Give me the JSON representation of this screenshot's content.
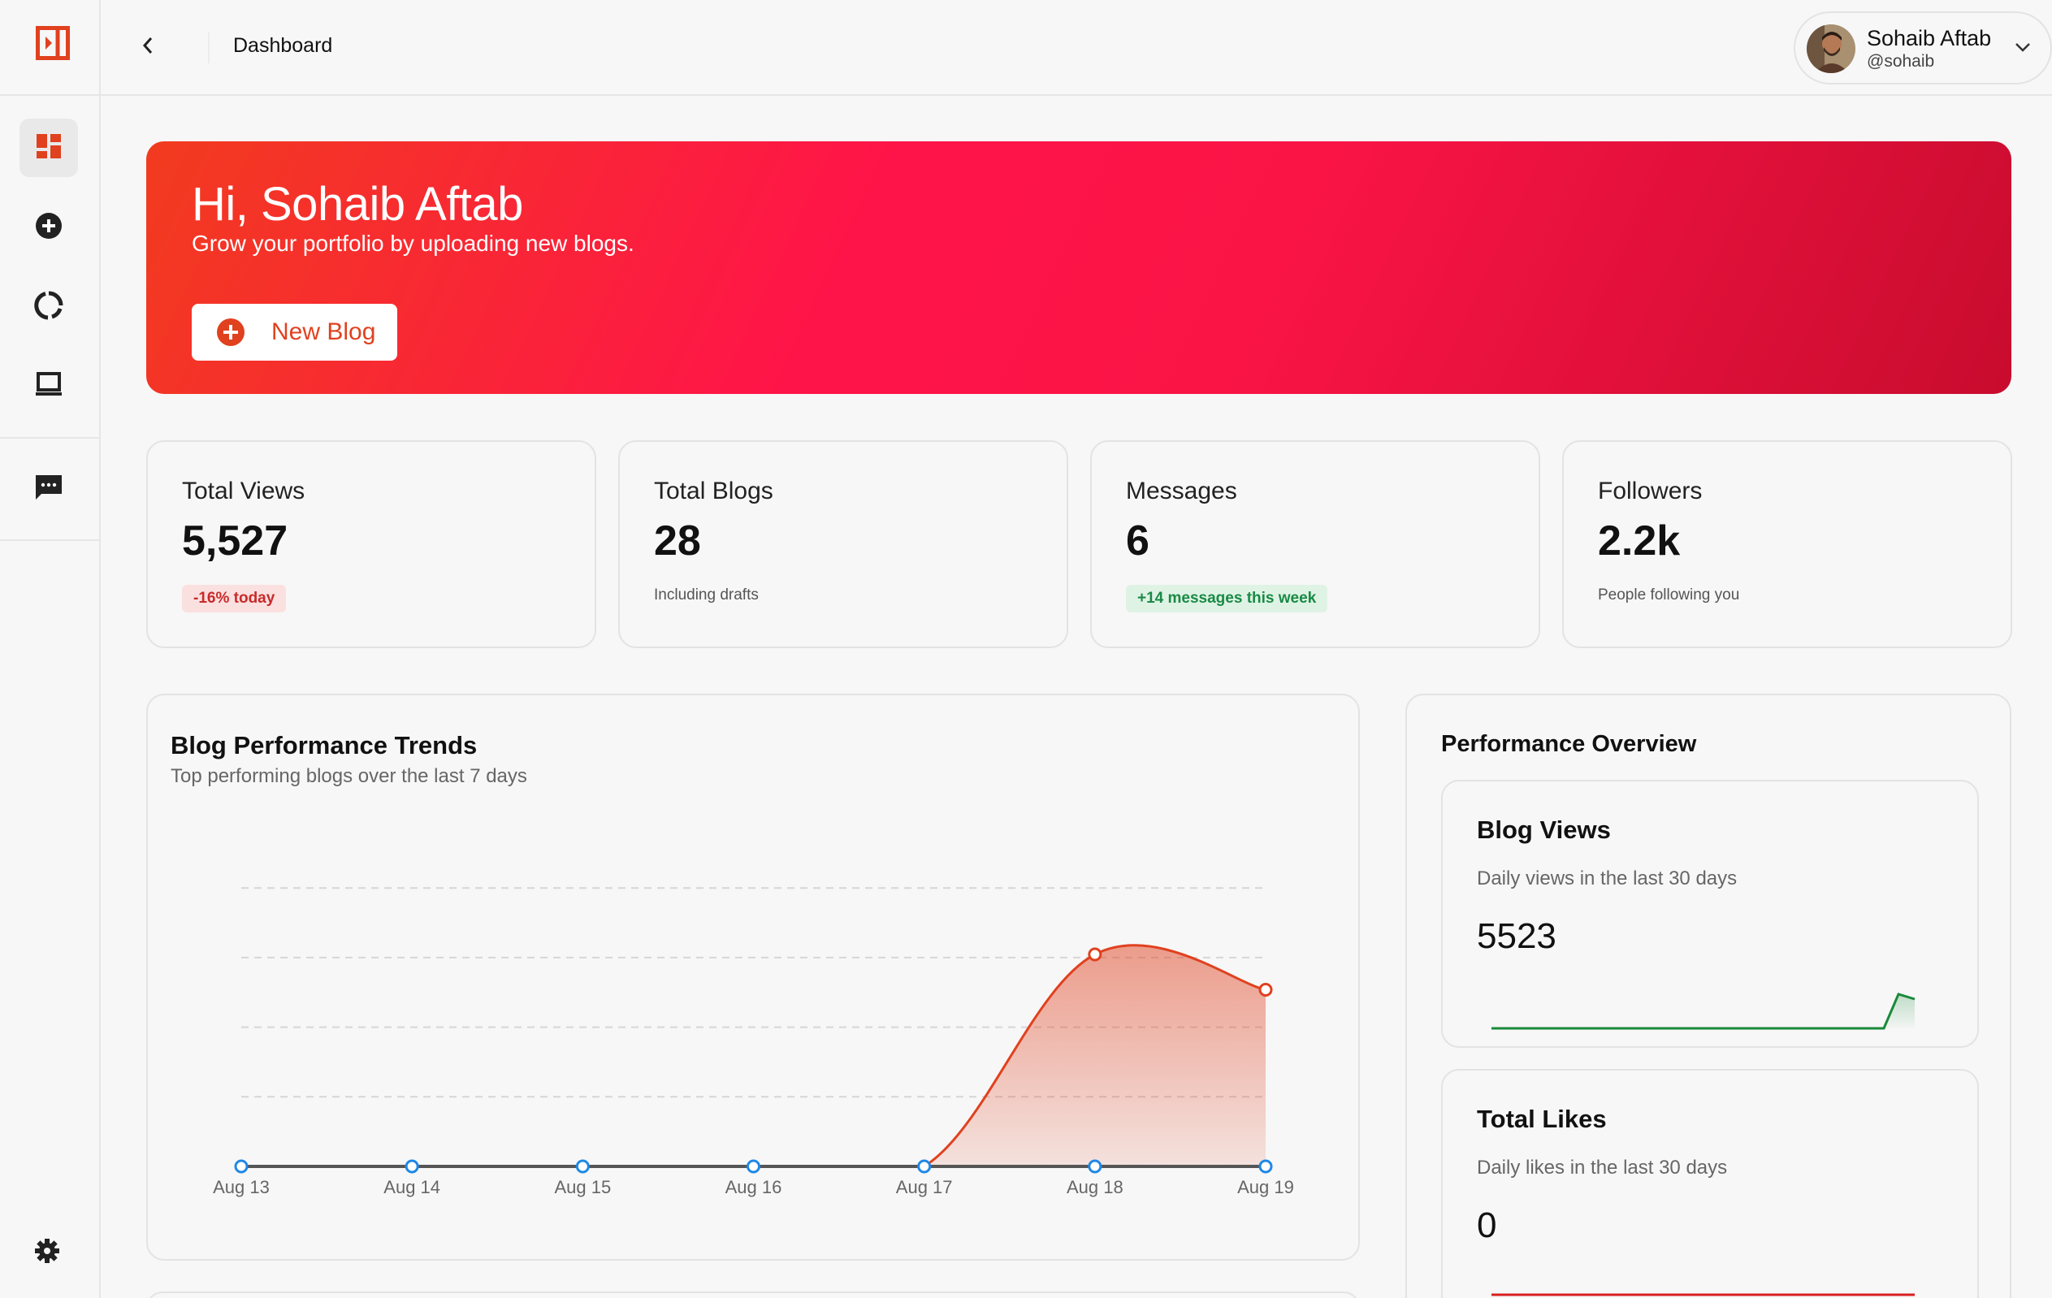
{
  "topbar": {
    "title": "Dashboard"
  },
  "user": {
    "name": "Sohaib Aftab",
    "handle": "@sohaib"
  },
  "hero": {
    "title": "Hi, Sohaib Aftab",
    "subtitle": "Grow your portfolio by uploading new blogs.",
    "button_label": "New Blog"
  },
  "stats": [
    {
      "label": "Total Views",
      "value": "5,527",
      "note": "-16% today",
      "note_style": "red"
    },
    {
      "label": "Total Blogs",
      "value": "28",
      "note": "Including drafts",
      "note_style": "plain"
    },
    {
      "label": "Messages",
      "value": "6",
      "note": "+14 messages this week",
      "note_style": "green"
    },
    {
      "label": "Followers",
      "value": "2.2k",
      "note": "People following you",
      "note_style": "plain"
    }
  ],
  "trend": {
    "title": "Blog Performance Trends",
    "subtitle": "Top performing blogs over the last 7 days"
  },
  "chart_data": {
    "type": "line",
    "title": "Blog Performance Trends",
    "x": [
      "Aug 13",
      "Aug 14",
      "Aug 15",
      "Aug 16",
      "Aug 17",
      "Aug 18",
      "Aug 19"
    ],
    "series": [
      {
        "values": [
          0,
          0,
          0,
          0,
          0,
          0,
          0
        ],
        "color": "#555555",
        "marker_color": "#1e88e5"
      },
      {
        "values": [
          0,
          0,
          0,
          0,
          0,
          3,
          2.5
        ],
        "color": "#e0411f",
        "fill": "area"
      }
    ],
    "ylim": [
      0,
      4
    ],
    "grid": true
  },
  "overview": {
    "title": "Performance Overview",
    "views": {
      "title": "Blog Views",
      "subtitle": "Daily views in the last 30 days",
      "value": "5523",
      "color": "#1a8a3a"
    },
    "likes": {
      "title": "Total Likes",
      "subtitle": "Daily likes in the last 30 days",
      "value": "0",
      "color": "#d92020"
    }
  },
  "colors": {
    "accent": "#e0411f",
    "hero_start": "#f23b1f",
    "hero_mid": "#ff1449",
    "hero_end": "#c80c2e"
  },
  "icons": [
    "sidebar-toggle-icon",
    "dashboard-icon",
    "add-circle-icon",
    "analytics-icon",
    "laptop-icon",
    "chat-icon",
    "settings-icon",
    "chevron-left-icon",
    "chevron-down-icon",
    "plus-circle-icon"
  ]
}
